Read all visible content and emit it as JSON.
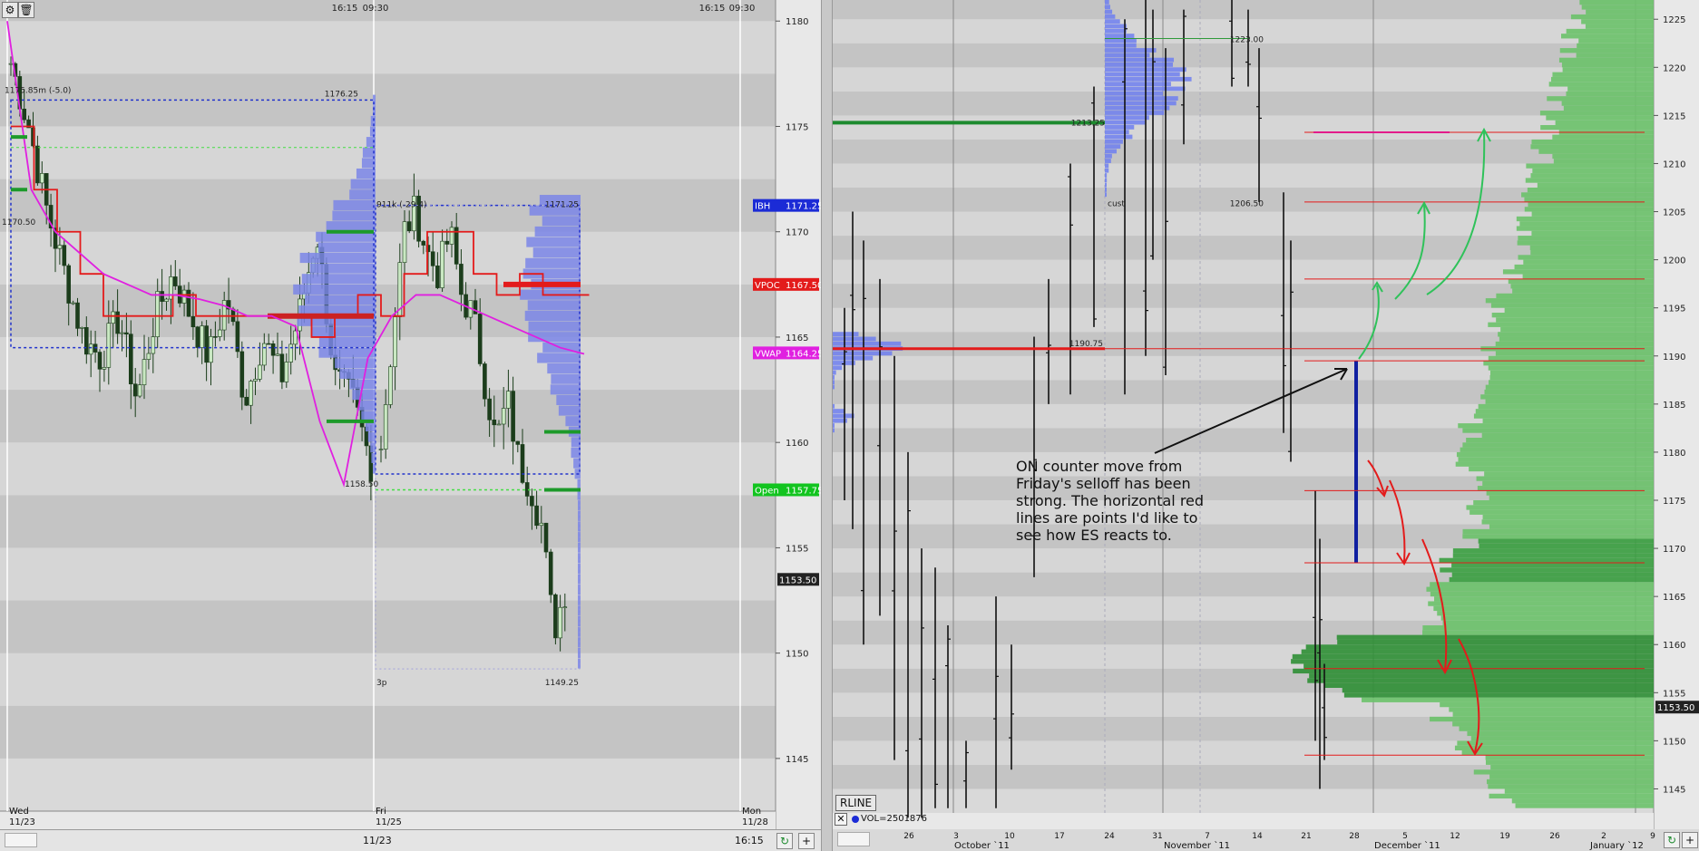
{
  "left_chart": {
    "toolbar_icons": [
      "settings-icon",
      "trash-icon"
    ],
    "session_times": [
      "16:15",
      "09:30",
      "16:15",
      "09:30"
    ],
    "price_axis": {
      "ticks": [
        1180,
        1175,
        1170,
        1165,
        1160,
        1155,
        1150,
        1145
      ],
      "min": 1142.5,
      "max": 1181
    },
    "markers": [
      {
        "label": "IBH",
        "value": "1171.25",
        "color": "#1b2bd6"
      },
      {
        "label": "VPOC",
        "value": "1167.50",
        "color": "#e31b1b"
      },
      {
        "label": "VWAP",
        "value": "1164.25",
        "color": "#e020e0"
      },
      {
        "label": "Open",
        "value": "1157.75",
        "color": "#12c41f"
      }
    ],
    "last_price": "1153.50",
    "profile_annotations": [
      "1176.25",
      "1175.85m (-5.0)",
      "911k (-29.4)",
      "1171.25",
      "1170.50",
      "1158.50",
      "3p",
      "1149.25"
    ],
    "time_axis": [
      {
        "day": "Wed",
        "date": "11/23"
      },
      {
        "day": "Fri",
        "date": "11/25"
      },
      {
        "day": "Mon",
        "date": "11/28"
      }
    ],
    "status_bar": {
      "date": "11/23",
      "time": "16:15",
      "refresh_icon": "refresh-icon",
      "add_label": "+"
    }
  },
  "right_chart": {
    "price_axis": {
      "ticks": [
        1225,
        1220,
        1215,
        1210,
        1205,
        1200,
        1195,
        1190,
        1185,
        1180,
        1175,
        1170,
        1165,
        1160,
        1155,
        1150,
        1145
      ],
      "min": 1142.5,
      "max": 1227
    },
    "last_price": "1153.50",
    "profile_labels": [
      "1223.00",
      "1213.25",
      "1206.50",
      "1190.75",
      "cust"
    ],
    "time_axis_days": [
      "26",
      "3",
      "10",
      "17",
      "24",
      "31",
      "7",
      "14",
      "21",
      "28",
      "5",
      "12",
      "19",
      "26",
      "2",
      "9"
    ],
    "time_axis_months": [
      "October `11",
      "November `11",
      "December `11",
      "January `12"
    ],
    "horizontal_red_lines": [
      1213.25,
      1206,
      1198,
      1190.75,
      1189.5,
      1176,
      1168.5,
      1157.5,
      1148.5
    ],
    "rline_button": "RLINE",
    "volume_label": "VOL=2501876",
    "annotation": "ON counter move from Friday's selloff has been strong. The horizontal red lines are points I'd like to see how ES reacts to.",
    "status_bar": {
      "refresh_icon": "refresh-icon",
      "add_label": "+",
      "close_icon": "close-icon"
    }
  },
  "colors": {
    "band_light": "#d8d8d8",
    "band_dark": "#bfbfbf",
    "profile_green": "#3aa545",
    "profile_blue": "#6f7ff0",
    "vwap": "#e020e0",
    "red": "#e31b1b"
  }
}
